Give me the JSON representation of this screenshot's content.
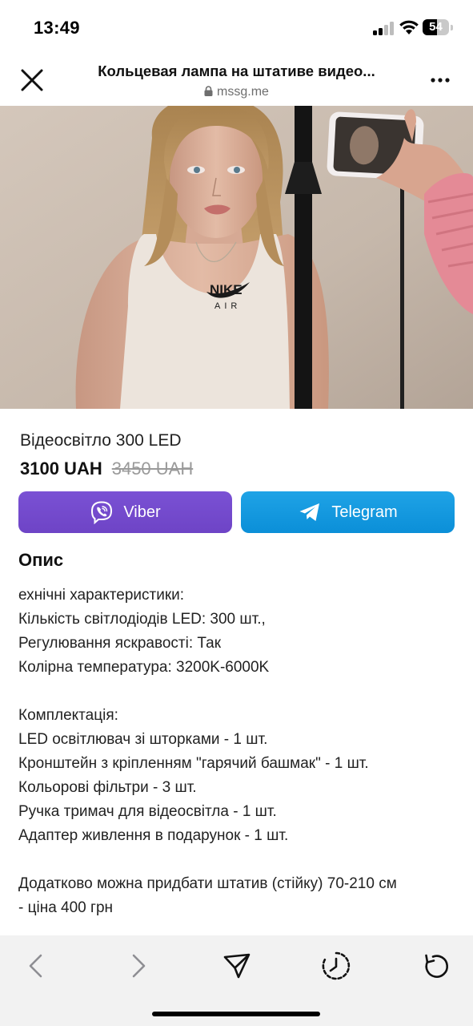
{
  "status_bar": {
    "time": "13:49",
    "battery": "54",
    "icons": [
      "signal-icon",
      "wifi-icon",
      "battery-icon"
    ]
  },
  "browser": {
    "page_title": "Кольцевая лампа на штативе видео...",
    "url": "mssg.me",
    "close_icon": "close-icon",
    "more_icon": "more-icon",
    "lock_icon": "lock-icon"
  },
  "hero": {
    "icon": "product-photo",
    "shirt_print": "AIR"
  },
  "product": {
    "name": "Відеосвітло 300 LED",
    "price": "3100 UAH",
    "old_price": "3450 UAH"
  },
  "actions": {
    "viber_label": "Viber",
    "telegram_label": "Telegram",
    "viber_color": "#7350cf",
    "telegram_color": "#1499e0"
  },
  "description": {
    "title": "Опис",
    "lines": [
      "ехнічні характеристики:",
      "Кількість світлодіодів LED: 300 шт.,",
      "Регулювання яскравості: Так",
      "Колірна температура: 3200K-6000K",
      "",
      "Комплектація:",
      "LED освітлювач зі шторками - 1 шт.",
      "Кронштейн з кріпленням \"гарячий башмак\" - 1 шт.",
      "Кольорові фільтри - 3 шт.",
      "Ручка тримач для відеосвітла - 1 шт.",
      "Адаптер живлення в подарунок - 1 шт.",
      "",
      "Додатково можна придбати штатив (стійку) 70-210 см",
      "- ціна 400 грн"
    ]
  },
  "toolbar": {
    "icons": [
      "back-icon",
      "forward-icon",
      "share-icon",
      "history-icon",
      "reload-icon"
    ],
    "disabled_color": "#8e8e93",
    "active_color": "#111111"
  }
}
